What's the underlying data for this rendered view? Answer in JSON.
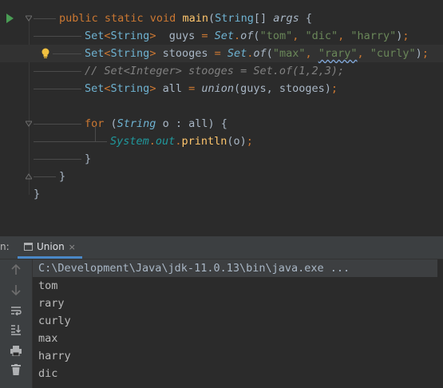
{
  "editor": {
    "lines": [
      {
        "parts": [
          [
            "kw",
            "public static void "
          ],
          [
            "fn",
            "main"
          ],
          [
            "",
            "("
          ],
          [
            "ty2",
            "String"
          ],
          [
            "",
            "[] "
          ],
          [
            "par",
            "args"
          ],
          [
            "",
            " {"
          ]
        ]
      },
      {
        "parts": [
          [
            "ty2",
            "Set"
          ],
          [
            "kw",
            "<"
          ],
          [
            "ty2",
            "String"
          ],
          [
            "kw",
            "> "
          ],
          [
            "",
            " guys "
          ],
          [
            "kw",
            "= "
          ],
          [
            "ty",
            "Set"
          ],
          [
            "kw",
            "."
          ],
          [
            "mth",
            "of"
          ],
          [
            "",
            "("
          ],
          [
            "str",
            "\"tom\""
          ],
          [
            "kw",
            ", "
          ],
          [
            "str",
            "\"dic\""
          ],
          [
            "kw",
            ", "
          ],
          [
            "str",
            "\"harry\""
          ],
          [
            "",
            ")"
          ],
          [
            "kw",
            ";"
          ]
        ]
      },
      {
        "parts": [
          [
            "ty2",
            "Set"
          ],
          [
            "kw",
            "<"
          ],
          [
            "ty2",
            "String"
          ],
          [
            "kw",
            "> "
          ],
          [
            "",
            "stooges "
          ],
          [
            "kw",
            "= "
          ],
          [
            "ty",
            "Set"
          ],
          [
            "kw",
            "."
          ],
          [
            "mth",
            "of"
          ],
          [
            "",
            "("
          ],
          [
            "str",
            "\"max\""
          ],
          [
            "kw",
            ", "
          ],
          [
            "str typo",
            "\"rary\""
          ],
          [
            "kw",
            ", "
          ],
          [
            "str",
            "\"curly\""
          ],
          [
            "",
            ")"
          ],
          [
            "kw",
            ";"
          ]
        ]
      },
      {
        "parts": [
          [
            "cmt",
            "// Set<Integer> stooges = Set.of(1,2,3);"
          ]
        ]
      },
      {
        "parts": [
          [
            "ty2",
            "Set"
          ],
          [
            "kw",
            "<"
          ],
          [
            "ty2",
            "String"
          ],
          [
            "kw",
            "> "
          ],
          [
            "",
            "all "
          ],
          [
            "kw",
            "= "
          ],
          [
            "mth",
            "union"
          ],
          [
            "",
            "(guys, stooges)"
          ],
          [
            "kw",
            ";"
          ]
        ]
      },
      {
        "parts": []
      },
      {
        "parts": [
          [
            "kw",
            "for "
          ],
          [
            "",
            "("
          ],
          [
            "ty",
            "String"
          ],
          [
            "",
            " o : all) {"
          ]
        ]
      },
      {
        "parts": [
          [
            "cls",
            "System"
          ],
          [
            "kw",
            "."
          ],
          [
            "cls",
            "out"
          ],
          [
            "kw",
            "."
          ],
          [
            "fn",
            "println"
          ],
          [
            "",
            "(o)"
          ],
          [
            "kw",
            ";"
          ]
        ]
      },
      {
        "parts": [
          [
            "",
            "}"
          ]
        ]
      },
      {
        "parts": [
          [
            "",
            "}"
          ]
        ]
      },
      {
        "parts": [
          [
            "",
            "}"
          ]
        ]
      }
    ]
  },
  "run_panel": {
    "tab_prefix": "n:",
    "tab_label": "Union",
    "tab_close": "×",
    "command": "C:\\Development\\Java\\jdk-11.0.13\\bin\\java.exe ...",
    "output": [
      "tom",
      "rary",
      "curly",
      "max",
      "harry",
      "dic"
    ],
    "sidebar_icons": [
      "up-arrow-icon",
      "down-arrow-icon",
      "soft-wrap-icon",
      "scroll-to-end-icon",
      "print-icon",
      "clear-icon"
    ]
  },
  "colors": {
    "background": "#2b2b2b",
    "keyword": "#cc7832",
    "string": "#6a8759",
    "comment": "#808080",
    "method": "#ffc66d",
    "type": "#6fb3d2",
    "tab_underline": "#4a88c7"
  }
}
